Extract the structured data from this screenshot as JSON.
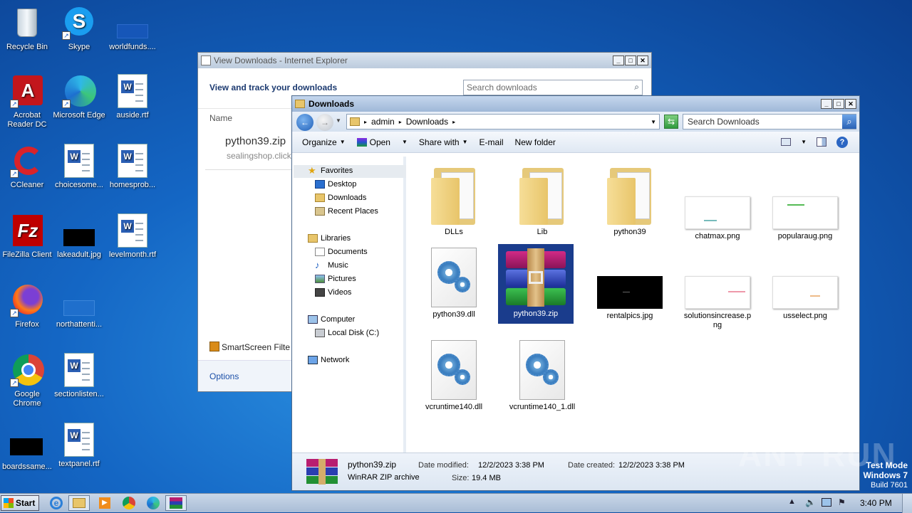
{
  "desktop": {
    "icons": [
      {
        "label": "Recycle Bin",
        "icon": "recycle-bin-icon"
      },
      {
        "label": "Skype",
        "icon": "skype-icon"
      },
      {
        "label": "worldfunds....",
        "icon": "image-file-icon"
      },
      {
        "label": "Acrobat Reader DC",
        "icon": "acrobat-icon"
      },
      {
        "label": "Microsoft Edge",
        "icon": "edge-icon"
      },
      {
        "label": "auside.rtf",
        "icon": "word-doc-icon"
      },
      {
        "label": "CCleaner",
        "icon": "ccleaner-icon"
      },
      {
        "label": "choicesome...",
        "icon": "word-doc-icon"
      },
      {
        "label": "homesprob...",
        "icon": "word-doc-icon"
      },
      {
        "label": "FileZilla Client",
        "icon": "filezilla-icon"
      },
      {
        "label": "lakeadult.jpg",
        "icon": "image-file-icon"
      },
      {
        "label": "levelmonth.rtf",
        "icon": "word-doc-icon"
      },
      {
        "label": "Firefox",
        "icon": "firefox-icon"
      },
      {
        "label": "northattenti...",
        "icon": "image-file-icon"
      },
      {
        "label": "Google Chrome",
        "icon": "chrome-icon"
      },
      {
        "label": "sectionlisten...",
        "icon": "word-doc-icon"
      },
      {
        "label": "boardssame...",
        "icon": "image-file-icon"
      },
      {
        "label": "textpanel.rtf",
        "icon": "word-doc-icon"
      }
    ]
  },
  "ie_window": {
    "title": "View Downloads - Internet Explorer",
    "heading": "View and track your downloads",
    "search_placeholder": "Search downloads",
    "column_name": "Name",
    "file_name": "python39.zip",
    "file_source": "sealingshop.click",
    "smartscreen": "SmartScreen Filte",
    "options": "Options"
  },
  "explorer": {
    "title": "Downloads",
    "breadcrumb": [
      "admin",
      "Downloads"
    ],
    "search_placeholder": "Search Downloads",
    "toolbar": {
      "organize": "Organize",
      "open": "Open",
      "share_with": "Share with",
      "email": "E-mail",
      "new_folder": "New folder"
    },
    "nav": {
      "favorites": "Favorites",
      "desktop": "Desktop",
      "downloads": "Downloads",
      "recent": "Recent Places",
      "libraries": "Libraries",
      "documents": "Documents",
      "music": "Music",
      "pictures": "Pictures",
      "videos": "Videos",
      "computer": "Computer",
      "local_disk": "Local Disk (C:)",
      "network": "Network"
    },
    "files": [
      {
        "name": "DLLs",
        "type": "folder"
      },
      {
        "name": "Lib",
        "type": "folder"
      },
      {
        "name": "python39",
        "type": "folder"
      },
      {
        "name": "chatmax.png",
        "type": "png"
      },
      {
        "name": "popularaug.png",
        "type": "png"
      },
      {
        "name": "python39.dll",
        "type": "dll"
      },
      {
        "name": "python39.zip",
        "type": "zip",
        "selected": true
      },
      {
        "name": "rentalpics.jpg",
        "type": "jpg"
      },
      {
        "name": "solutionsincrease.png",
        "type": "png"
      },
      {
        "name": "usselect.png",
        "type": "png"
      },
      {
        "name": "vcruntime140.dll",
        "type": "dll"
      },
      {
        "name": "vcruntime140_1.dll",
        "type": "dll"
      }
    ],
    "details": {
      "name": "python39.zip",
      "kind": "WinRAR ZIP archive",
      "modified_label": "Date modified:",
      "modified": "12/2/2023 3:38 PM",
      "size_label": "Size:",
      "size": "19.4 MB",
      "created_label": "Date created:",
      "created": "12/2/2023 3:38 PM"
    }
  },
  "taskbar": {
    "start": "Start",
    "clock": "3:40 PM"
  },
  "watermark": {
    "mode": "Test Mode",
    "os": "Windows 7",
    "build": "Build 7601",
    "brand": "ANY RUN"
  },
  "colors": {
    "selection": "#1a3c8c",
    "accent": "#1c50a8"
  }
}
